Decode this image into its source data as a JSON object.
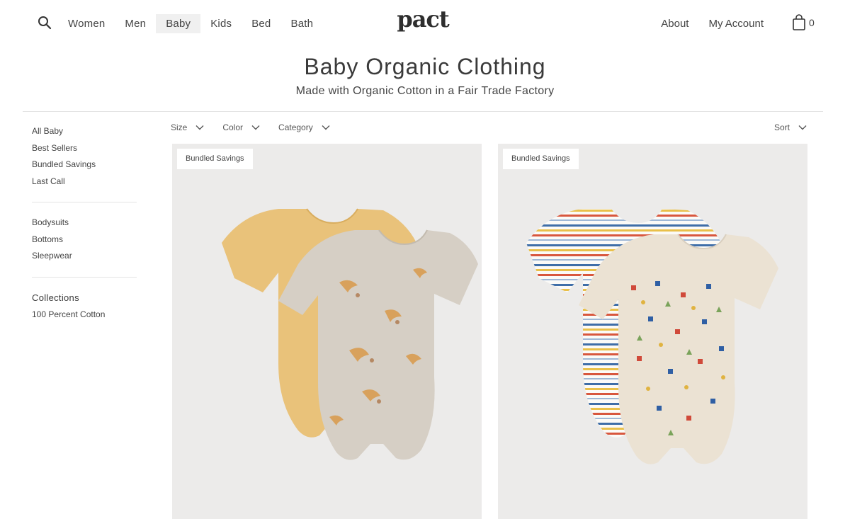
{
  "header": {
    "nav": [
      "Women",
      "Men",
      "Baby",
      "Kids",
      "Bed",
      "Bath"
    ],
    "active_nav": "Baby",
    "logo_text": "pact",
    "about": "About",
    "account": "My Account",
    "cart_count": "0"
  },
  "page": {
    "title": "Baby Organic Clothing",
    "subtitle": "Made with Organic Cotton in a Fair Trade Factory"
  },
  "sidebar": {
    "group1": [
      "All Baby",
      "Best Sellers",
      "Bundled Savings",
      "Last Call"
    ],
    "group2": [
      "Bodysuits",
      "Bottoms",
      "Sleepwear"
    ],
    "collections_heading": "Collections",
    "group3": [
      "100 Percent Cotton"
    ]
  },
  "filters": {
    "size": "Size",
    "color": "Color",
    "category": "Category",
    "sort": "Sort"
  },
  "products": [
    {
      "badge": "Bundled Savings"
    },
    {
      "badge": "Bundled Savings"
    }
  ],
  "colors": {
    "card_bg": "#ecebea",
    "active_nav_bg": "#f0f0f0",
    "mustard": "#e9c27a",
    "oatmeal": "#d6cfc5"
  },
  "icons": {
    "search": "search-icon",
    "cart": "shopping-bag-icon",
    "chevron": "chevron-down-icon"
  }
}
